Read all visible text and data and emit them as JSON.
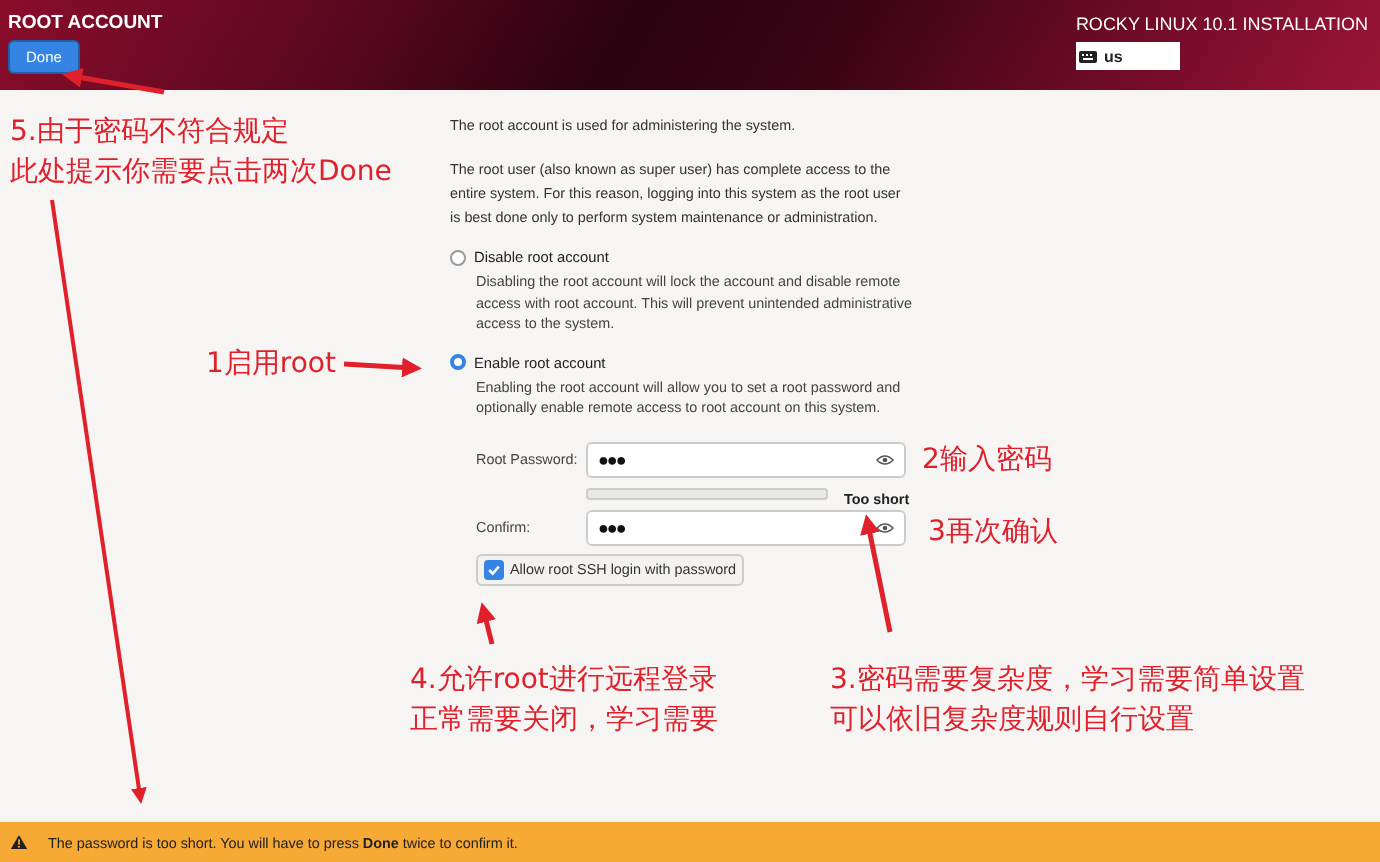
{
  "header": {
    "title": "ROOT ACCOUNT",
    "done_button": "Done",
    "product": "ROCKY LINUX 10.1 INSTALLATION",
    "keyboard_layout": "us"
  },
  "intro": [
    "The root account is used for administering the system.",
    "The root user (also known as super user) has complete access to the entire system. For this reason, logging into this system as the root user is best done only to perform system maintenance or administration."
  ],
  "options": [
    {
      "label": "Disable root account",
      "selected": false,
      "description": "Disabling the root account will lock the account and disable remote access with root account. This will prevent unintended administrative access to the system."
    },
    {
      "label": "Enable root account",
      "selected": true,
      "description": "Enabling the root account will allow you to set a root password and optionally enable remote access to root account on this system."
    }
  ],
  "password": {
    "label": "Root Password:",
    "value": "●●●",
    "level": 0,
    "strength": "Too short"
  },
  "confirm": {
    "label": "Confirm:",
    "value": "●●●"
  },
  "ssh_login": {
    "label": "Allow root SSH login with password",
    "checked": true
  },
  "status_bar": {
    "message": "The password is too short. You will have to press **Done** twice to confirm it."
  },
  "annotations": [
    {
      "lines": [
        "5.由于密码不符合规定",
        "此处提示你需要点击两次Done"
      ]
    },
    {
      "lines": [
        "1启用root"
      ]
    },
    {
      "lines": [
        "2输入密码"
      ]
    },
    {
      "lines": [
        "3再次确认"
      ]
    },
    {
      "lines": [
        "4.允许root进行远程登录",
        "正常需要关闭，学习需要"
      ]
    },
    {
      "lines": [
        "3.密码需要复杂度，学习需要简单设置",
        "可以依旧复杂度规则自行设置"
      ]
    }
  ]
}
